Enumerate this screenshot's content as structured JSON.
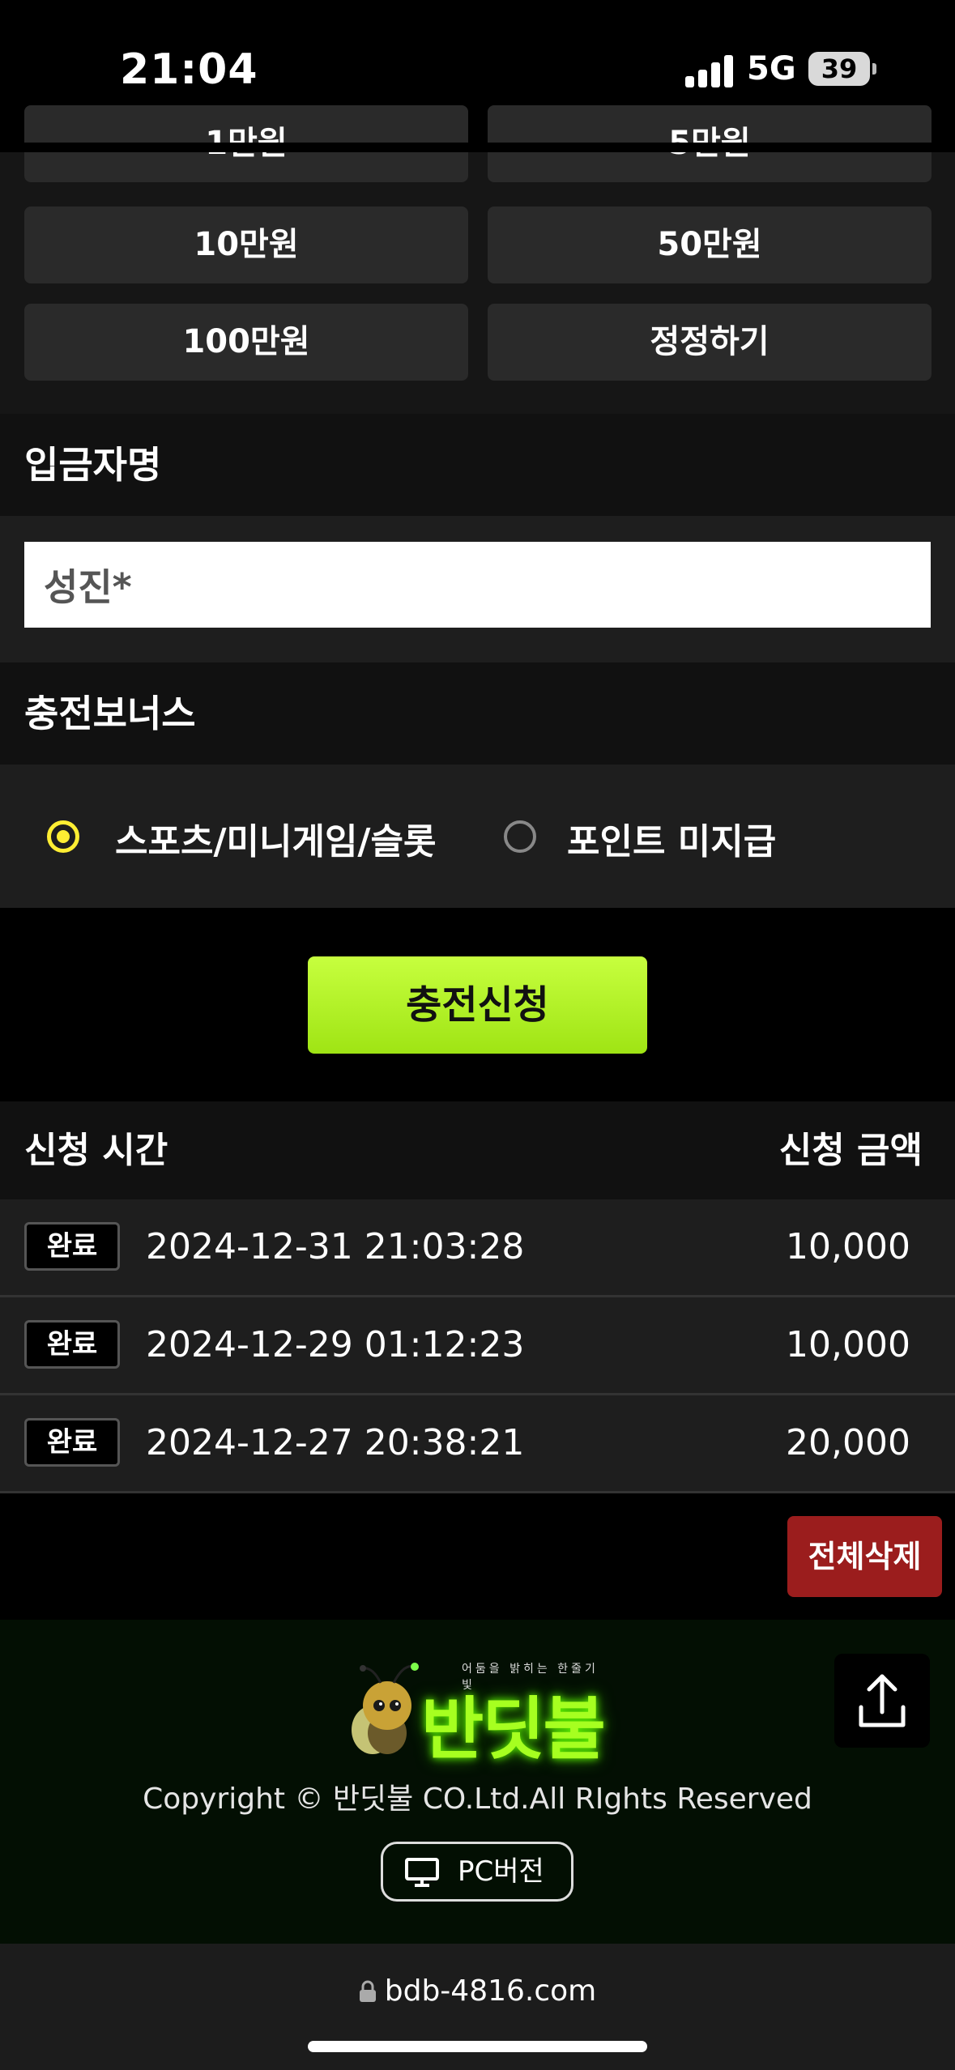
{
  "status_bar": {
    "time": "21:04",
    "network": "5G",
    "battery": "39"
  },
  "amount_buttons": {
    "row0": [
      "1만원",
      "5만원"
    ],
    "row1": [
      "10만원",
      "50만원"
    ],
    "row2": [
      "100만원",
      "정정하기"
    ]
  },
  "depositor": {
    "label": "입금자명",
    "value": "성진*"
  },
  "bonus": {
    "label": "충전보너스",
    "options": [
      {
        "label": "스포츠/미니게임/슬롯",
        "selected": true
      },
      {
        "label": "포인트 미지급",
        "selected": false
      }
    ]
  },
  "submit_label": "충전신청",
  "history": {
    "col_time": "신청 시간",
    "col_amount": "신청 금액",
    "rows": [
      {
        "status": "완료",
        "datetime": "2024-12-31 21:03:28",
        "amount": "10,000"
      },
      {
        "status": "완료",
        "datetime": "2024-12-29 01:12:23",
        "amount": "10,000"
      },
      {
        "status": "완료",
        "datetime": "2024-12-27 20:38:21",
        "amount": "20,000"
      }
    ],
    "delete_all_label": "전체삭제"
  },
  "footer": {
    "logo_text": "반딧불",
    "logo_tagline": "어둠을 밝히는 한줄기 빛",
    "copyright": "Copyright © 반딧불 CO.Ltd.All RIghts Reserved",
    "pc_version_label": "PC버전"
  },
  "browser": {
    "url": "bdb-4816.com"
  },
  "colors": {
    "accent_green": "#a6ff20",
    "radio_yellow": "#ffee33",
    "delete_red": "#9b1d1d"
  }
}
